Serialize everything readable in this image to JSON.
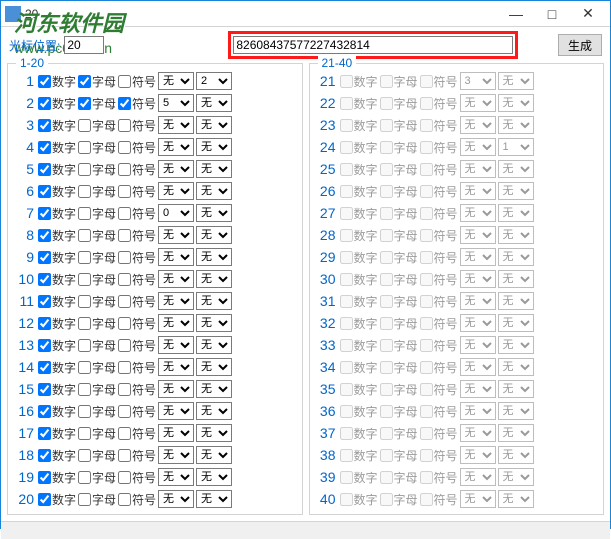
{
  "window": {
    "title": "20"
  },
  "top": {
    "pos_label": "光标位置:",
    "pos_value": "20",
    "main_value": "82608437577227432814",
    "generate_label": "生成"
  },
  "labels": {
    "digit": "数字",
    "letter": "字母",
    "symbol": "符号",
    "none": "无"
  },
  "groups": [
    {
      "legend": "1-20",
      "rows": [
        {
          "n": 1,
          "d": true,
          "l": true,
          "s": false,
          "sel1": "无",
          "sel2": "2"
        },
        {
          "n": 2,
          "d": true,
          "l": true,
          "s": true,
          "sel1": "5",
          "sel2": "无"
        },
        {
          "n": 3,
          "d": true,
          "l": false,
          "s": false,
          "sel1": "无",
          "sel2": "无"
        },
        {
          "n": 4,
          "d": true,
          "l": false,
          "s": false,
          "sel1": "无",
          "sel2": "无"
        },
        {
          "n": 5,
          "d": true,
          "l": false,
          "s": false,
          "sel1": "无",
          "sel2": "无"
        },
        {
          "n": 6,
          "d": true,
          "l": false,
          "s": false,
          "sel1": "无",
          "sel2": "无"
        },
        {
          "n": 7,
          "d": true,
          "l": false,
          "s": false,
          "sel1": "0",
          "sel2": "无"
        },
        {
          "n": 8,
          "d": true,
          "l": false,
          "s": false,
          "sel1": "无",
          "sel2": "无"
        },
        {
          "n": 9,
          "d": true,
          "l": false,
          "s": false,
          "sel1": "无",
          "sel2": "无"
        },
        {
          "n": 10,
          "d": true,
          "l": false,
          "s": false,
          "sel1": "无",
          "sel2": "无"
        },
        {
          "n": 11,
          "d": true,
          "l": false,
          "s": false,
          "sel1": "无",
          "sel2": "无"
        },
        {
          "n": 12,
          "d": true,
          "l": false,
          "s": false,
          "sel1": "无",
          "sel2": "无"
        },
        {
          "n": 13,
          "d": true,
          "l": false,
          "s": false,
          "sel1": "无",
          "sel2": "无"
        },
        {
          "n": 14,
          "d": true,
          "l": false,
          "s": false,
          "sel1": "无",
          "sel2": "无"
        },
        {
          "n": 15,
          "d": true,
          "l": false,
          "s": false,
          "sel1": "无",
          "sel2": "无"
        },
        {
          "n": 16,
          "d": true,
          "l": false,
          "s": false,
          "sel1": "无",
          "sel2": "无"
        },
        {
          "n": 17,
          "d": true,
          "l": false,
          "s": false,
          "sel1": "无",
          "sel2": "无"
        },
        {
          "n": 18,
          "d": true,
          "l": false,
          "s": false,
          "sel1": "无",
          "sel2": "无"
        },
        {
          "n": 19,
          "d": true,
          "l": false,
          "s": false,
          "sel1": "无",
          "sel2": "无"
        },
        {
          "n": 20,
          "d": true,
          "l": false,
          "s": false,
          "sel1": "无",
          "sel2": "无"
        }
      ],
      "enabled": true
    },
    {
      "legend": "21-40",
      "rows": [
        {
          "n": 21,
          "d": false,
          "l": false,
          "s": false,
          "sel1": "3",
          "sel2": "无"
        },
        {
          "n": 22,
          "d": false,
          "l": false,
          "s": false,
          "sel1": "无",
          "sel2": "无"
        },
        {
          "n": 23,
          "d": false,
          "l": false,
          "s": false,
          "sel1": "无",
          "sel2": "无"
        },
        {
          "n": 24,
          "d": false,
          "l": false,
          "s": false,
          "sel1": "无",
          "sel2": "1"
        },
        {
          "n": 25,
          "d": false,
          "l": false,
          "s": false,
          "sel1": "无",
          "sel2": "无"
        },
        {
          "n": 26,
          "d": false,
          "l": false,
          "s": false,
          "sel1": "无",
          "sel2": "无"
        },
        {
          "n": 27,
          "d": false,
          "l": false,
          "s": false,
          "sel1": "无",
          "sel2": "无"
        },
        {
          "n": 28,
          "d": false,
          "l": false,
          "s": false,
          "sel1": "无",
          "sel2": "无"
        },
        {
          "n": 29,
          "d": false,
          "l": false,
          "s": false,
          "sel1": "无",
          "sel2": "无"
        },
        {
          "n": 30,
          "d": false,
          "l": false,
          "s": false,
          "sel1": "无",
          "sel2": "无"
        },
        {
          "n": 31,
          "d": false,
          "l": false,
          "s": false,
          "sel1": "无",
          "sel2": "无"
        },
        {
          "n": 32,
          "d": false,
          "l": false,
          "s": false,
          "sel1": "无",
          "sel2": "无"
        },
        {
          "n": 33,
          "d": false,
          "l": false,
          "s": false,
          "sel1": "无",
          "sel2": "无"
        },
        {
          "n": 34,
          "d": false,
          "l": false,
          "s": false,
          "sel1": "无",
          "sel2": "无"
        },
        {
          "n": 35,
          "d": false,
          "l": false,
          "s": false,
          "sel1": "无",
          "sel2": "无"
        },
        {
          "n": 36,
          "d": false,
          "l": false,
          "s": false,
          "sel1": "无",
          "sel2": "无"
        },
        {
          "n": 37,
          "d": false,
          "l": false,
          "s": false,
          "sel1": "无",
          "sel2": "无"
        },
        {
          "n": 38,
          "d": false,
          "l": false,
          "s": false,
          "sel1": "无",
          "sel2": "无"
        },
        {
          "n": 39,
          "d": false,
          "l": false,
          "s": false,
          "sel1": "无",
          "sel2": "无"
        },
        {
          "n": 40,
          "d": false,
          "l": false,
          "s": false,
          "sel1": "无",
          "sel2": "无"
        }
      ],
      "enabled": false
    }
  ],
  "watermark": {
    "logo_main": "河东软件园",
    "url": "www.pc0359.cn"
  }
}
